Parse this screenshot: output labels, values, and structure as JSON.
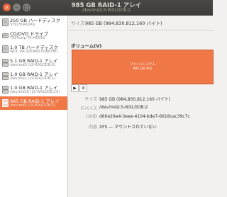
{
  "window": {
    "title": "985 GB RAID-1 アレイ",
    "subtitle": "/dev/md/LS-WXLDDB:2"
  },
  "sidebar": {
    "devices": [
      {
        "name": "250 GB ハードディスク",
        "sub": "ST9250410AS",
        "icon": "hard-disk-icon"
      },
      {
        "name": "CD/DVD ドライブ",
        "sub": "TSSTcorp TS-H653G",
        "icon": "optical-drive-icon"
      },
      {
        "name": "1.0 TB ハードディスク",
        "sub": "WDC WD10EARX-00N0YB0",
        "icon": "hard-disk-icon"
      },
      {
        "name": "5.1 GB RAID-1 アレイ",
        "sub": "/dev/md0 (LS-WXLDDB:0)",
        "icon": "raid-icon"
      },
      {
        "name": "1.0 GB RAID-1 アレイ",
        "sub": "/dev/md1 (LS-WXLDDB:1)",
        "icon": "raid-icon"
      },
      {
        "name": "1.0 GB RAID-1 アレイ",
        "sub": "/dev/md10 (LS-WXLDDB:10)",
        "icon": "raid-icon"
      },
      {
        "name": "985 GB RAID-1 アレイ",
        "sub": "/dev/md2 (LS-WXLDDB:2)",
        "icon": "raid-icon",
        "selected": true
      }
    ]
  },
  "main": {
    "size_label": "サイズ",
    "size_value": "985 GB (984,830,812,160 バイト)",
    "volumes_heading": "ボリューム(V)",
    "volume_box": {
      "line1": "ファイルシステム",
      "line2": "985 GB XFS"
    },
    "toolbar": {
      "play_icon": "▶",
      "settings_icon": "⚙"
    },
    "properties": [
      {
        "label": "サイズ",
        "value": "985 GB (984,830,812,160 バイト)"
      },
      {
        "label": "デバイス",
        "value": "/dev/md/LS-WXLDDB:2"
      },
      {
        "label": "UUID",
        "value": "d60e29a4-3eee-4104-bde7-6618cac39c7c"
      },
      {
        "label": "内容",
        "value": "XFS — マウントされていない"
      }
    ]
  },
  "colors": {
    "accent": "#f07746",
    "titlebar": "#3c3b37"
  }
}
